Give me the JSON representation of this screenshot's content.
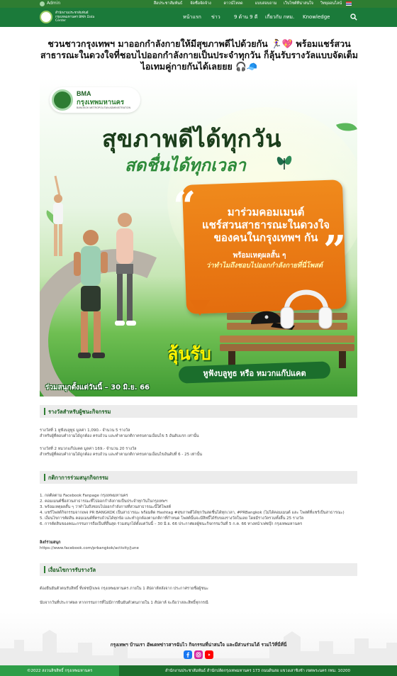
{
  "topbar": {
    "admin_label": "Admin",
    "links": [
      "สื่อประชาสัมพันธ์",
      "จัดซื้อจัดจ้าง",
      "ดาวน์โหลด",
      "แบบสอบถาม",
      "เว็บไซต์ที่น่าสนใจ",
      "วิทยุออนไลน์"
    ]
  },
  "nav": {
    "logo_text": "สำนักงานประชาสัมพันธ์ กรุงเทพมหานคร BMA Data Center",
    "menu": {
      "home": "หน้าแรก",
      "news": "ข่าว",
      "ninenine": "9 ด้าน 9 ดี",
      "about": "เกี่ยวกับ กทม.",
      "knowledge": "Knowledge"
    }
  },
  "article": {
    "title": "ชวนชาวกรุงเทพฯ มาออกกำลังกายให้มีสุขภาพดีไปด้วยกัน 🏃‍♀️💖 พร้อมแชร์สวนสาธารณะในดวงใจที่ชอบไปออกกำลังกายเป็นประจำทุกวัน ก็ลุ้นรับรางวัลแบบจัดเต็ม ไอเทมคู่กายกันได้เลยยย 🎧🧢"
  },
  "poster": {
    "bma_label": "BMA",
    "bma_name": "กรุงเทพมหานคร",
    "bma_sub": "BANGKOK METROPOLITAN ADMINISTRATION",
    "headline1": "สุขภาพดีได้ทุกวัน",
    "headline2": "สดชื่นได้ทุกเวลา",
    "bubble_line1": "มาร่วมคอมเมนต์",
    "bubble_line2": "แชร์สวนสาธารณะในดวงใจ",
    "bubble_line3": "ของคนในกรุงเทพฯ กัน",
    "bubble_line4": "พร้อมเหตุผลสั้น ๆ",
    "bubble_line5": "ว่าทำไมถึงชอบไปออกกำลังกายที่นี่โพสต์",
    "prize_big": "ลุ้นรับ",
    "prize_sub": "หูฟังบลูทูธ หรือ หมวกแก๊ปแคต",
    "period": "ร่วมสนุกตั้งแต่วันนี้ – 30 มิ.ย. 66"
  },
  "sections": {
    "prizes": {
      "heading": "รางวัลสำหรับผู้ชนะกิจกรรม",
      "p1a": "รางวัลที่ 1 หูฟังบลูทูธ มูลค่า 1,090.- จำนวน 5 รางวัล",
      "p1b": "สำหรับผู้ที่ตอบคำถามได้ถูกต้อง ครบถ้วน และทำตามกติกาครบตามเงื่อนไข 5 อันดับแรก เท่านั้น",
      "p2a": "รางวัลที่ 2 หมวกแก๊ปแคต มูลค่า 169.- จำนวน 20 รางวัล",
      "p2b": "สำหรับผู้ที่ตอบคำถามได้ถูกต้อง ครบถ้วน และทำตามกติกาครบตามเงื่อนไขอันดับที่ 6 - 25 เท่านั้น"
    },
    "rules": {
      "heading": "กติกาการร่วมสนุกกิจกรรม",
      "items": [
        "1. กดติดตาม Facebook Fanpage กรุงเทพมหานคร",
        "2. คอมเมนต์ชื่อสวนสาธารณะที่ไปออกกำลังกายเป็นประจำทุกวันในกรุงเทพฯ",
        "3. พร้อมเหตุผลสั้น ๆ ว่าทำไมถึงชอบไปออกกำลังกายที่สวนสาธารณะนี้ใต้โพสต์",
        "4. แชร์โพสต์กิจกรรมจากเพจ PR BANGKOK เป็นสาธารณะ พร้อมติด Hashtag #สุขภาพดีได้ทุกวันสดชื่นได้ทุกเวลา, #PRBangkok (ไม่ได้คอมเมนต์ และ โพสต์ที่แชร์เป็นสาธารณะ)",
        "5. เงื่อนไขการตัดสิน คอมเมนต์ที่ครบถ้วนได้ทุกข้อ และทำถูกต้องตามกติกาที่กำหนด โพสต์นั้นจะมีสิทธิ์ได้รับของรางวัลในเลย โดยมีรางวัลรวมทั้งสิ้น 25 รางวัล",
        "6. การตัดสินของคณะกรรมการถือเป็นที่สิ้นสุด ร่วมสนุกได้ตั้งแต่วันนี้ – 30 มิ.ย. 66 ประกาศผลผู้ชนะกิจกรรมวันที่ 5 ก.ค. 66 ทางหน้าเฟซบุ๊ก กรุงเทพมหานคร"
      ],
      "link_label": "ลิงก์ร่วมสนุก",
      "link_url": "https://www.facebook.com/prbangkok/activity/june"
    },
    "conditions": {
      "heading": "เงื่อนไขการรับรางวัล",
      "c1": "ต้องยืนยันตัวตนรับสิทธิ์ ที่เฟซบุ๊กเพจ กรุงเทพมหานคร ภายใน 1 สัปดาห์หลังจาก ประกาศรายชื่อผู้ชนะ",
      "c2": "นับจากวันที่ประกาศผล หากกรรมการที่ไม่มีการยืนยันตัวตนภายใน 1 สัปดาห์ จะถือว่าสละสิทธิ์ทุกกรณี"
    }
  },
  "footer": {
    "message": "กรุงเทพฯ บ้านเรา อัพเดทข่าวสารฉับไว กิจกรรมที่น่าสนใจ และมีส่วนร่วมได้ รวมไว้ที่นี่ที่นี่",
    "copyright": "©2022 สงวนลิขสิทธิ์ กรุงเทพมหานคร",
    "address": "สำนักงานประชาสัมพันธ์ สำนักปลัดกรุงเทพมหานคร 173 ถนนดินสอ แขวงเสาชิงช้า เขตพระนคร กทม. 10200"
  },
  "colors": {
    "brand_green": "#1b7a3a",
    "accent_orange": "#e46d0e",
    "section_bg": "#ececec"
  }
}
